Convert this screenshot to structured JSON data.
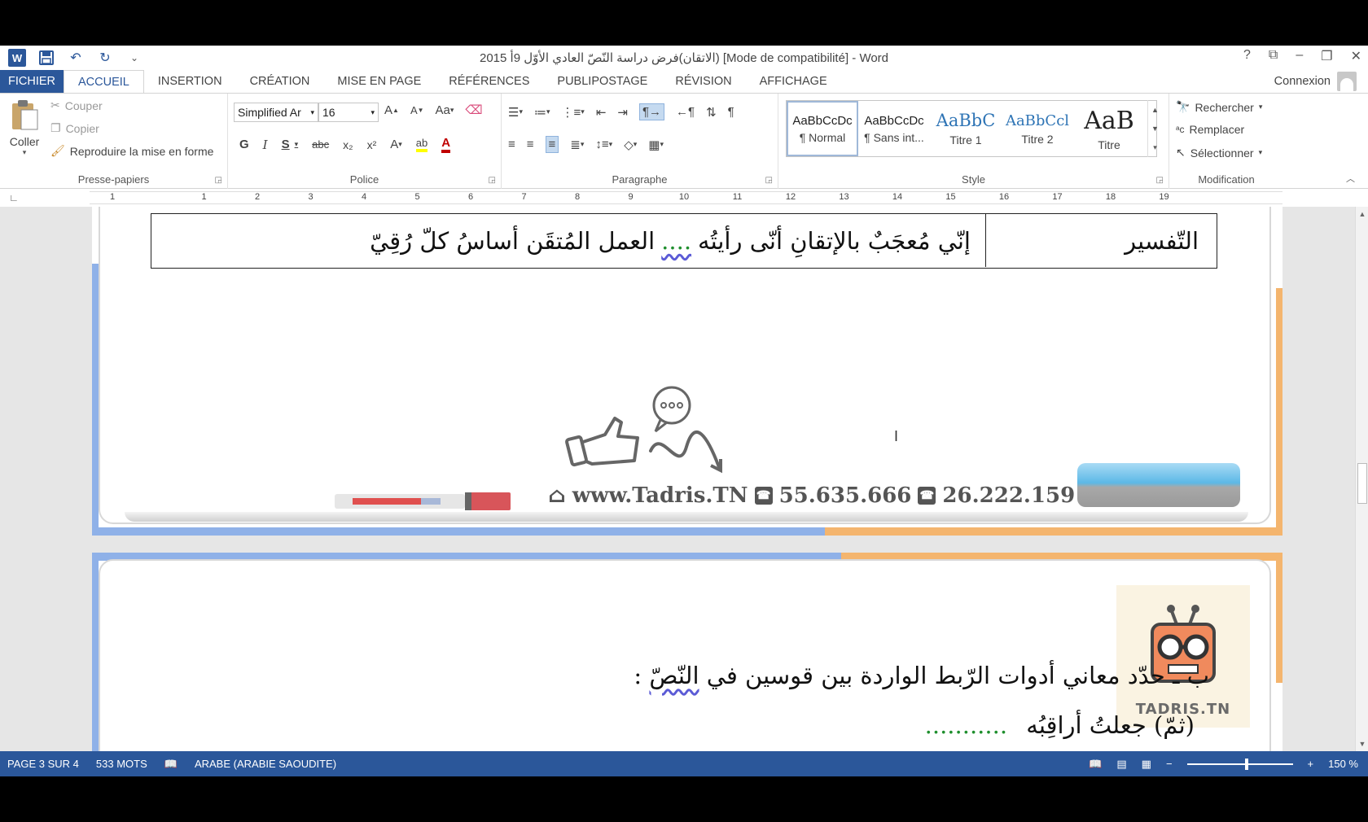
{
  "window": {
    "title": "2015 الاتقان)فرض دراسة النّصّ العادي الأوّل 9أ) [Mode de compatibilité] - Word",
    "help": "?",
    "controls": [
      "⧉",
      "–",
      "❐",
      "✕"
    ]
  },
  "qat": {
    "undo": "↶",
    "redo": "↻",
    "customize": "⌄"
  },
  "tabs": [
    "FICHIER",
    "ACCUEIL",
    "INSERTION",
    "CRÉATION",
    "MISE EN PAGE",
    "RÉFÉRENCES",
    "PUBLIPOSTAGE",
    "RÉVISION",
    "AFFICHAGE"
  ],
  "active_tab": "ACCUEIL",
  "account": {
    "label": "Connexion"
  },
  "clipboard": {
    "paste": "Coller",
    "cut": "Couper",
    "copy": "Copier",
    "format_painter": "Reproduire la mise en forme",
    "group": "Presse-papiers"
  },
  "font": {
    "name": "Simplified Ar",
    "size": "16",
    "grow": "A",
    "shrink": "A",
    "case": "Aa",
    "bold": "G",
    "italic": "I",
    "underline": "S",
    "strike": "abc",
    "sub": "x₂",
    "sup": "x²",
    "effects": "A",
    "highlight": "ab",
    "color": "A",
    "group": "Police",
    "accent": "#c00000"
  },
  "paragraph": {
    "group": "Paragraphe"
  },
  "styles": {
    "items": [
      {
        "preview": "AaBbCcDc",
        "name": "¶ Normal"
      },
      {
        "preview": "AaBbCcDc",
        "name": "¶ Sans int..."
      },
      {
        "preview": "AaBbC",
        "name": "Titre 1"
      },
      {
        "preview": "AaBbCcl",
        "name": "Titre 2"
      },
      {
        "preview": "AaB",
        "name": "Titre"
      }
    ],
    "group": "Style"
  },
  "editing": {
    "find": "Rechercher",
    "replace": "Remplacer",
    "select": "Sélectionner",
    "group": "Modification"
  },
  "ruler": {
    "numbers": [
      "1",
      "1",
      "2",
      "3",
      "4",
      "5",
      "6",
      "7",
      "8",
      "9",
      "10",
      "11",
      "12",
      "13",
      "14",
      "15",
      "16",
      "17",
      "18",
      "19"
    ]
  },
  "document": {
    "table_label": "التّفسير",
    "table_text_a": "إنّي مُعجَبٌ بالإتقانِ أنّى رأيتُه",
    "table_dots": "....",
    "table_text_b": "العمل المُتقَن أساسُ كلّ رُقِيّ",
    "footer_site": "www.Tadris.TN",
    "footer_phone1": "55.635.666",
    "footer_phone2": "26.222.159",
    "question_prefix": "ب ـ",
    "question": "حدّد معاني أدوات الرّبط الواردة بين قوسين في",
    "question_word": "النّصّ",
    "question_suffix": " :",
    "answer": "(ثمّ) جعلتُ أراقِبُه",
    "answer_dots": "...........",
    "logo_text": "TADRIS.TN"
  },
  "status": {
    "page": "PAGE 3 SUR 4",
    "words": "533 MOTS",
    "language": "ARABE (ARABIE SAOUDITE)",
    "zoom": "150 %",
    "zoom_level": 150,
    "color": "#2b579a"
  }
}
